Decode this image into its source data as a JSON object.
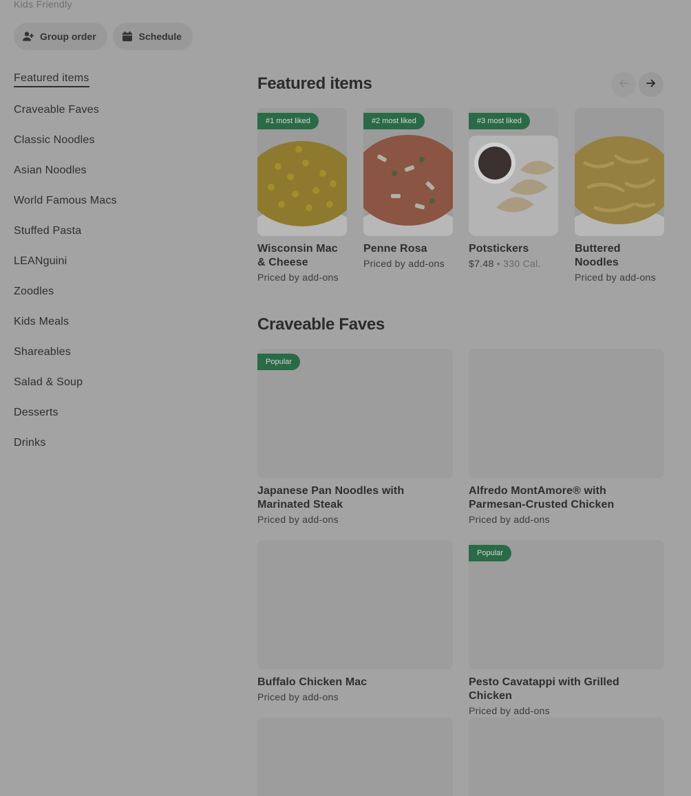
{
  "header": {
    "tag": "Kids Friendly",
    "group_order_label": "Group order",
    "schedule_label": "Schedule"
  },
  "sidebar": {
    "items": [
      {
        "label": "Featured items"
      },
      {
        "label": "Craveable Faves"
      },
      {
        "label": "Classic Noodles"
      },
      {
        "label": "Asian Noodles"
      },
      {
        "label": "World Famous Macs"
      },
      {
        "label": "Stuffed Pasta"
      },
      {
        "label": "LEANguini"
      },
      {
        "label": "Zoodles"
      },
      {
        "label": "Kids Meals"
      },
      {
        "label": "Shareables"
      },
      {
        "label": "Salad & Soup"
      },
      {
        "label": "Desserts"
      },
      {
        "label": "Drinks"
      }
    ]
  },
  "featured": {
    "title": "Featured items",
    "items": [
      {
        "badge": "#1 most liked",
        "name": "Wisconsin Mac & Cheese",
        "sub": "Priced by add-ons"
      },
      {
        "badge": "#2 most liked",
        "name": "Penne Rosa",
        "sub": "Priced by add-ons"
      },
      {
        "badge": "#3 most liked",
        "name": "Potstickers",
        "price": "$7.48",
        "sep": "•",
        "cal": "330 Cal."
      },
      {
        "badge": "",
        "name": "Buttered Noodles",
        "sub": "Priced by add-ons"
      }
    ]
  },
  "craveable": {
    "title": "Craveable Faves",
    "items": [
      {
        "badge": "Popular",
        "name": "Japanese Pan Noodles with Marinated Steak",
        "sub": "Priced by add-ons"
      },
      {
        "badge": "",
        "name": "Alfredo MontAmore® with Parmesan-Crusted Chicken",
        "sub": "Priced by add-ons"
      },
      {
        "badge": "",
        "name": "Buffalo Chicken Mac",
        "sub": "Priced by add-ons"
      },
      {
        "badge": "Popular",
        "name": "Pesto Cavatappi with Grilled Chicken",
        "sub": "Priced by add-ons"
      }
    ]
  },
  "colors": {
    "badge_green": "#2a6a47",
    "overlay_gray": "#a3a3a3"
  }
}
